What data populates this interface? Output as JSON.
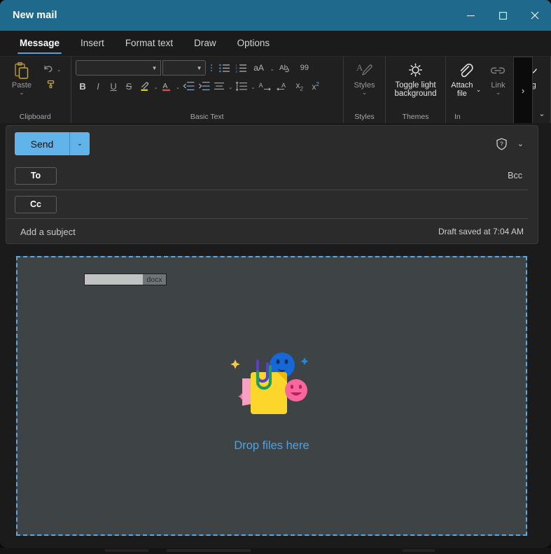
{
  "window": {
    "title": "New mail",
    "controls": {
      "minimize": "minimize-icon",
      "maximize": "maximize-icon",
      "close": "close-icon"
    },
    "accent_color": "#1f6a8c"
  },
  "tabs": [
    {
      "label": "Message",
      "active": true
    },
    {
      "label": "Insert",
      "active": false
    },
    {
      "label": "Format text",
      "active": false
    },
    {
      "label": "Draw",
      "active": false
    },
    {
      "label": "Options",
      "active": false
    }
  ],
  "ribbon": {
    "groups": [
      {
        "name": "clipboard",
        "label": "Clipboard",
        "paste": {
          "label": "Paste",
          "icon": "paste-icon",
          "has_dropdown": true,
          "enabled": false
        },
        "undo": {
          "icon": "undo-icon",
          "has_dropdown": true
        },
        "format_painter": {
          "icon": "format-painter-icon"
        }
      },
      {
        "name": "basic-text",
        "label": "Basic Text",
        "font_name": {
          "value": "",
          "placeholder": ""
        },
        "font_size": {
          "value": "",
          "placeholder": ""
        },
        "buttons": [
          "bold",
          "italic",
          "underline",
          "strikethrough",
          "highlight",
          "font-color",
          "decrease-indent",
          "increase-indent",
          "bullets",
          "numbering",
          "change-case",
          "clear-formatting",
          "quote",
          "align",
          "line-spacing",
          "ltr",
          "rtl",
          "subscript",
          "superscript"
        ],
        "glyphs": {
          "bold": "B",
          "italic": "I",
          "underline": "U",
          "strikethrough": "S",
          "change_case": "aA",
          "clear_formatting": "Ab",
          "quote": "99",
          "subscript": "x",
          "superscript": "x",
          "subscript_sub": "2",
          "superscript_sup": "2"
        }
      },
      {
        "name": "styles",
        "label": "Styles",
        "button": {
          "label": "Styles",
          "icon": "styles-icon",
          "has_dropdown": true,
          "enabled": false
        }
      },
      {
        "name": "themes",
        "label": "Themes",
        "button": {
          "label": "Toggle light background",
          "icon": "sun-icon",
          "enabled": true
        }
      },
      {
        "name": "include",
        "label": "In",
        "attach_file": {
          "label": "Attach file",
          "icon": "paperclip-icon",
          "has_dropdown": true,
          "enabled": true
        },
        "link": {
          "label": "Link",
          "icon": "link-icon",
          "has_dropdown": true,
          "enabled": false
        },
        "signature": {
          "label": "Sig",
          "icon": "signature-icon",
          "enabled": true
        }
      }
    ],
    "overflow_button": "›",
    "collapse_button": "⌄"
  },
  "compose": {
    "send": {
      "label": "Send",
      "dropdown": "⌄",
      "color": "#60b4ea"
    },
    "sensitivity": {
      "icon": "shield-question-icon"
    },
    "options_dropdown": "⌄",
    "fields": [
      {
        "name": "to",
        "label": "To",
        "value": "",
        "placeholder": ""
      },
      {
        "name": "cc",
        "label": "Cc",
        "value": "",
        "placeholder": ""
      }
    ],
    "bcc_label": "Bcc",
    "subject": {
      "value": "",
      "placeholder": "Add a subject"
    },
    "draft_status": "Draft saved at 7:04 AM"
  },
  "body": {
    "dropzone": {
      "label": "Drop files here",
      "label_color": "#4ea2e0",
      "border_color": "#5aa9e6",
      "background": "#3e4346",
      "illustration": "drop-files-illustration"
    },
    "drag_preview": {
      "extension": "docx",
      "bar_color": "#c2c2c2"
    }
  }
}
